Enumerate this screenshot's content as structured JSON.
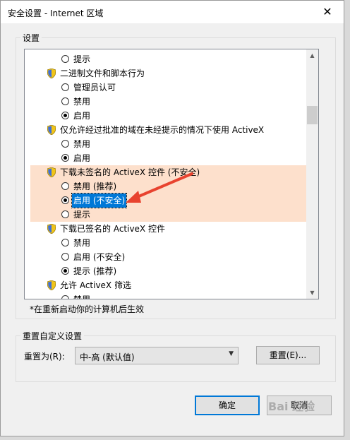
{
  "window": {
    "title": "安全设置 - Internet 区域",
    "close_glyph": "✕"
  },
  "settings": {
    "group_label": "设置",
    "rows": [
      {
        "kind": "radio",
        "label": "提示",
        "checked": false
      },
      {
        "kind": "header",
        "label": "二进制文件和脚本行为"
      },
      {
        "kind": "radio",
        "label": "管理员认可",
        "checked": false
      },
      {
        "kind": "radio",
        "label": "禁用",
        "checked": false
      },
      {
        "kind": "radio",
        "label": "启用",
        "checked": true
      },
      {
        "kind": "header",
        "label": "仅允许经过批准的域在未经提示的情况下使用 ActiveX"
      },
      {
        "kind": "radio",
        "label": "禁用",
        "checked": false
      },
      {
        "kind": "radio",
        "label": "启用",
        "checked": true
      },
      {
        "kind": "header",
        "label": "下载未签名的 ActiveX 控件 (不安全)",
        "highlight": true
      },
      {
        "kind": "radio",
        "label": "禁用 (推荐)",
        "checked": false,
        "highlight": true
      },
      {
        "kind": "radio",
        "label": "启用 (不安全)",
        "checked": true,
        "highlight": true,
        "selected": true
      },
      {
        "kind": "radio",
        "label": "提示",
        "checked": false,
        "highlight": true
      },
      {
        "kind": "header",
        "label": "下载已签名的 ActiveX 控件"
      },
      {
        "kind": "radio",
        "label": "禁用",
        "checked": false
      },
      {
        "kind": "radio",
        "label": "启用 (不安全)",
        "checked": false
      },
      {
        "kind": "radio",
        "label": "提示 (推荐)",
        "checked": true
      },
      {
        "kind": "header",
        "label": "允许 ActiveX 筛选"
      },
      {
        "kind": "radio",
        "label": "禁用",
        "checked": false
      }
    ],
    "note": "*在重新启动你的计算机后生效"
  },
  "reset": {
    "group_label": "重置自定义设置",
    "reset_to_label": "重置为(R):",
    "dropdown_value": "中-高 (默认值)",
    "reset_button": "重置(E)..."
  },
  "footer": {
    "ok": "确定",
    "cancel": "取消"
  },
  "watermark": "Bai 经验",
  "colors": {
    "highlight": "#fde0cc",
    "selection": "#0078d7",
    "arrow": "#e8432f"
  }
}
